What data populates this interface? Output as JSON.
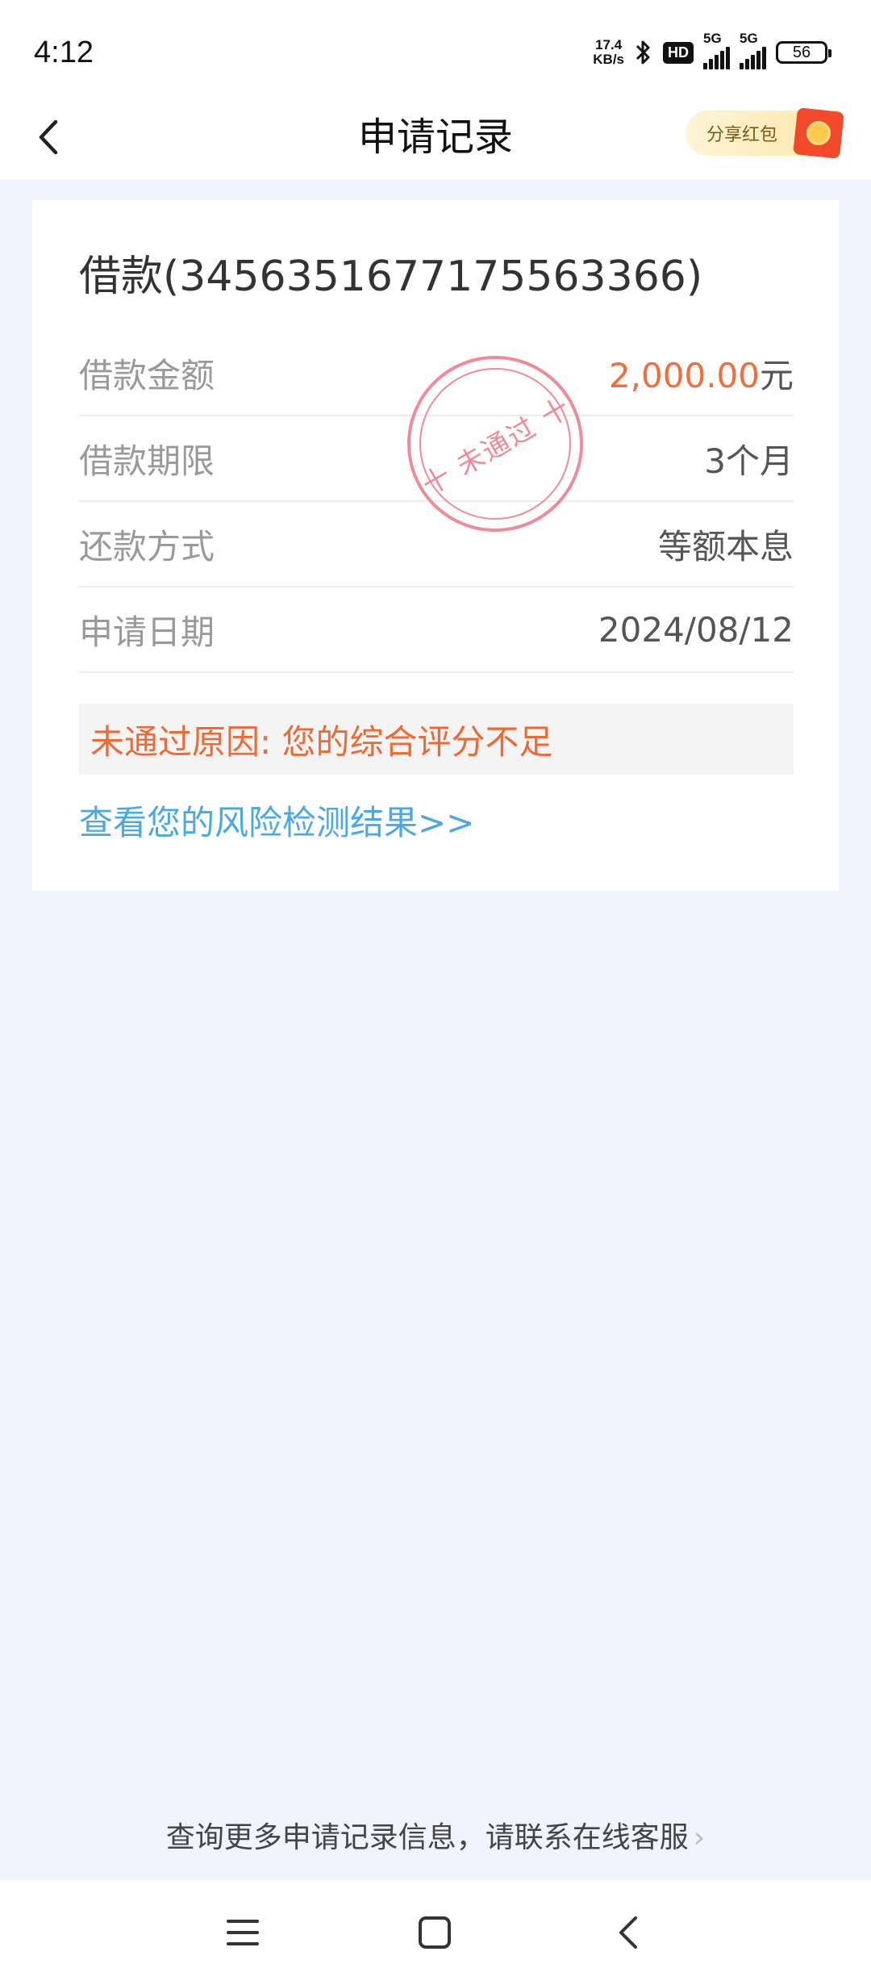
{
  "status_bar": {
    "time": "4:12",
    "net_speed_value": "17.4",
    "net_speed_unit": "KB/s",
    "hd_label": "HD",
    "signal1_label": "5G",
    "signal2_label": "5G",
    "battery": "56"
  },
  "header": {
    "title": "申请记录",
    "share_label": "分享红包"
  },
  "loan": {
    "title": "借款(3456351677175563366)",
    "rows": [
      {
        "label": "借款金额",
        "value": "2,000.00",
        "unit": "元"
      },
      {
        "label": "借款期限",
        "value": "3个月"
      },
      {
        "label": "还款方式",
        "value": "等额本息"
      },
      {
        "label": "申请日期",
        "value": "2024/08/12"
      }
    ],
    "stamp_text": "十 未通过 十",
    "reason": "未通过原因: 您的综合评分不足",
    "risk_link": "查看您的风险检测结果>>"
  },
  "footer": {
    "hint": "查询更多申请记录信息，请联系在线客服",
    "chevron": "›"
  },
  "colors": {
    "accent_orange": "#f26d3a",
    "link_blue": "#4aa8e8",
    "stamp_pink": "#ef8a98",
    "page_bg": "#f0f4fd"
  },
  "icons": {
    "back": "chevron-left-icon",
    "bluetooth": "bluetooth-icon",
    "menu": "menu-icon",
    "home": "home-square-icon",
    "nav_back": "nav-back-icon"
  }
}
